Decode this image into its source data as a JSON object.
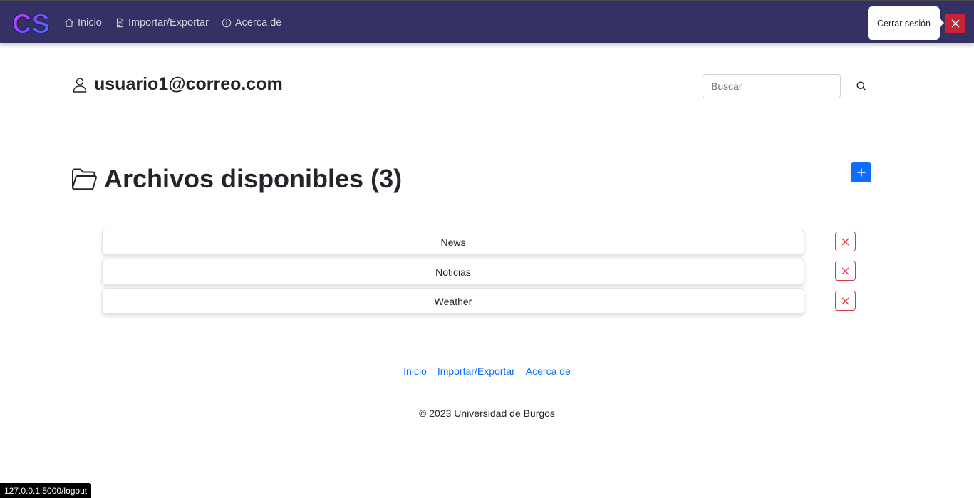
{
  "navbar": {
    "logo_text": "CS",
    "links": [
      {
        "label": "Inicio",
        "icon": "house-icon"
      },
      {
        "label": "Importar/Exportar",
        "icon": "file-icon"
      },
      {
        "label": "Acerca de",
        "icon": "info-circle-icon"
      }
    ],
    "logout_tooltip": "Cerrar sesión",
    "logout_icon": "close-icon"
  },
  "user": {
    "email": "usuario1@correo.com",
    "icon": "user-icon"
  },
  "search": {
    "placeholder": "Buscar",
    "value": "",
    "icon": "search-icon"
  },
  "files": {
    "title": "Archivos disponibles (3)",
    "icon": "folder-icon",
    "add_icon": "plus-icon",
    "items": [
      {
        "name": "News"
      },
      {
        "name": "Noticias"
      },
      {
        "name": "Weather"
      }
    ]
  },
  "footer": {
    "links": [
      "Inicio",
      "Importar/Exportar",
      "Acerca de"
    ],
    "copyright": "© 2023 Universidad de Burgos"
  },
  "status_bar": {
    "url": "127.0.0.1:5000/logout"
  },
  "colors": {
    "navbar_bg": "#343264",
    "primary": "#0d6efd",
    "danger": "#dc3545"
  }
}
